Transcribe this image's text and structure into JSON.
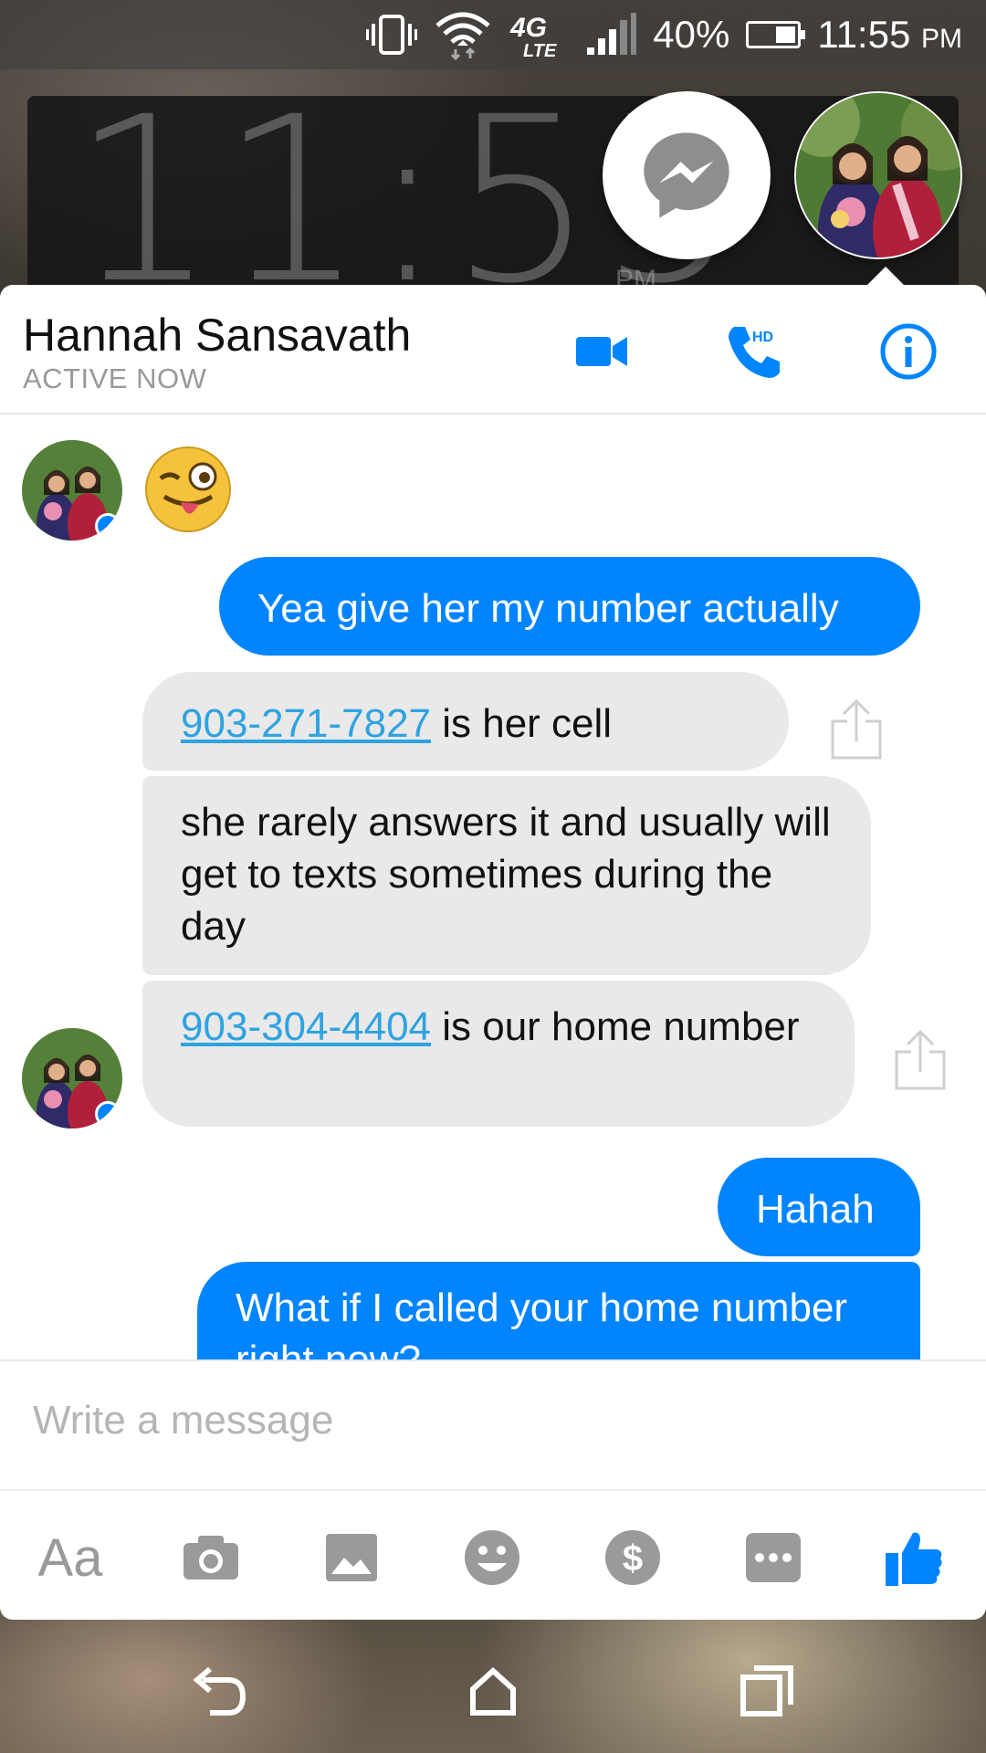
{
  "status_bar": {
    "battery": "40%",
    "time": "11:55",
    "ampm": "PM",
    "network": "4G LTE",
    "icons": [
      "vibrate-icon",
      "wifi-icon",
      "4g-lte-icon",
      "signal-icon",
      "battery-icon"
    ]
  },
  "lockscreen": {
    "clock": "11:55",
    "ampm": "PM"
  },
  "chat": {
    "contact_name": "Hannah Sansavath",
    "presence": "ACTIVE NOW",
    "header_icons": [
      "video-call-icon",
      "hd-phone-icon",
      "info-icon"
    ],
    "messages": [
      {
        "from": "contact",
        "type": "emoji",
        "emoji": "😜"
      },
      {
        "from": "me",
        "text": "Yea give her my number actually"
      },
      {
        "from": "contact",
        "link": "903-271-7827",
        "text": " is her cell"
      },
      {
        "from": "contact",
        "text": "she rarely answers it and usually will get to texts sometimes during the day"
      },
      {
        "from": "contact",
        "link": "903-304-4404",
        "text": " is our home number"
      },
      {
        "from": "me",
        "text": "Hahah"
      },
      {
        "from": "me",
        "text": "What if I called your home number right now?"
      }
    ],
    "composer_placeholder": "Write a message",
    "toolbar": {
      "text_label": "Aa",
      "icons": [
        "text-format-icon",
        "camera-icon",
        "gallery-icon",
        "emoji-icon",
        "payment-icon",
        "more-icon",
        "thumbs-up-icon"
      ]
    }
  },
  "nav": {
    "icons": [
      "back-icon",
      "home-icon",
      "recents-icon"
    ]
  },
  "colors": {
    "accent": "#0084ff",
    "incoming_bubble": "#e9e9e9",
    "link": "#2fa3e0"
  }
}
